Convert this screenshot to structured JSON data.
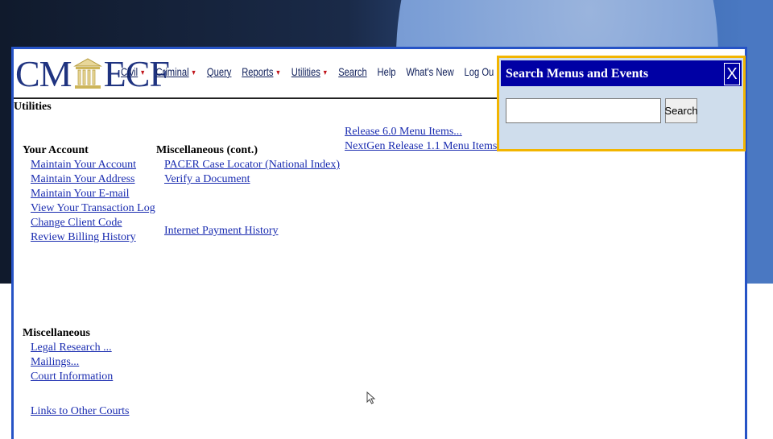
{
  "app": {
    "logo_left": "CM",
    "logo_right": "ECF"
  },
  "menu": {
    "items": [
      {
        "label": "Civil",
        "dropdown": true
      },
      {
        "label": "Criminal",
        "dropdown": true
      },
      {
        "label": "Query",
        "dropdown": false
      },
      {
        "label": "Reports",
        "dropdown": true
      },
      {
        "label": "Utilities",
        "dropdown": true
      },
      {
        "label": "Search",
        "dropdown": false
      },
      {
        "label": "Help",
        "dropdown": false
      },
      {
        "label": "What's New",
        "dropdown": false
      },
      {
        "label": "Log Ou",
        "dropdown": false
      }
    ],
    "dropdown_color": "#c0151b"
  },
  "page": {
    "title": "Utilities"
  },
  "your_account": {
    "heading": "Your Account",
    "links": [
      "Maintain Your Account",
      "Maintain Your Address",
      "Maintain Your E-mail",
      "View Your Transaction Log",
      "Change Client Code",
      "Review Billing History"
    ]
  },
  "misc_cont": {
    "heading": "Miscellaneous (cont.)",
    "links": [
      "PACER Case Locator (National Index)",
      "Verify a Document",
      "Internet Payment History"
    ]
  },
  "releases": {
    "links": [
      "Release 6.0 Menu Items...",
      "NextGen Release 1.1 Menu Items"
    ]
  },
  "misc": {
    "heading": "Miscellaneous",
    "links": [
      "Legal Research ...",
      "Mailings...",
      "Court Information",
      "Links to Other Courts"
    ]
  },
  "search_panel": {
    "title": "Search Menus and Events",
    "close_label": "X",
    "input_value": "",
    "button_label": "Search",
    "highlight_color": "#f2b500",
    "title_bar_color": "#0000a4"
  },
  "colors": {
    "link": "#1a2cb0",
    "window_border": "#2653c6"
  }
}
